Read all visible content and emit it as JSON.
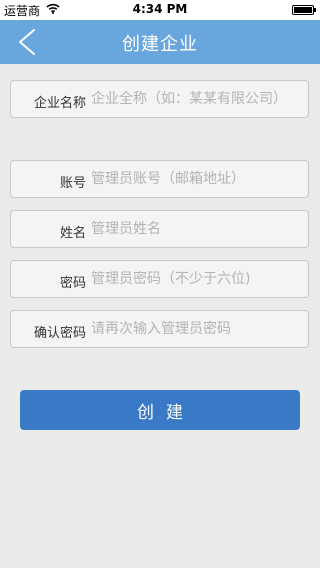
{
  "status_bar": {
    "carrier": "运营商",
    "time": "4:34 PM",
    "wifi_icon": "wifi-icon",
    "battery_icon": "battery-icon"
  },
  "nav": {
    "title": "创建企业",
    "back_icon": "chevron-left-icon",
    "background_color": "#69a6dd"
  },
  "form": {
    "company_name": {
      "label": "企业名称",
      "placeholder": "企业全称（如：某某有限公司）",
      "value": ""
    },
    "account": {
      "label": "账号",
      "placeholder": "管理员账号（邮箱地址）",
      "value": ""
    },
    "name": {
      "label": "姓名",
      "placeholder": "管理员姓名",
      "value": ""
    },
    "password": {
      "label": "密码",
      "placeholder": "管理员密码（不少于六位)",
      "value": ""
    },
    "confirm_password": {
      "label": "确认密码",
      "placeholder": "请再次输入管理员密码",
      "value": ""
    }
  },
  "create_button": {
    "label": "创建",
    "color": "#3a79c6"
  }
}
